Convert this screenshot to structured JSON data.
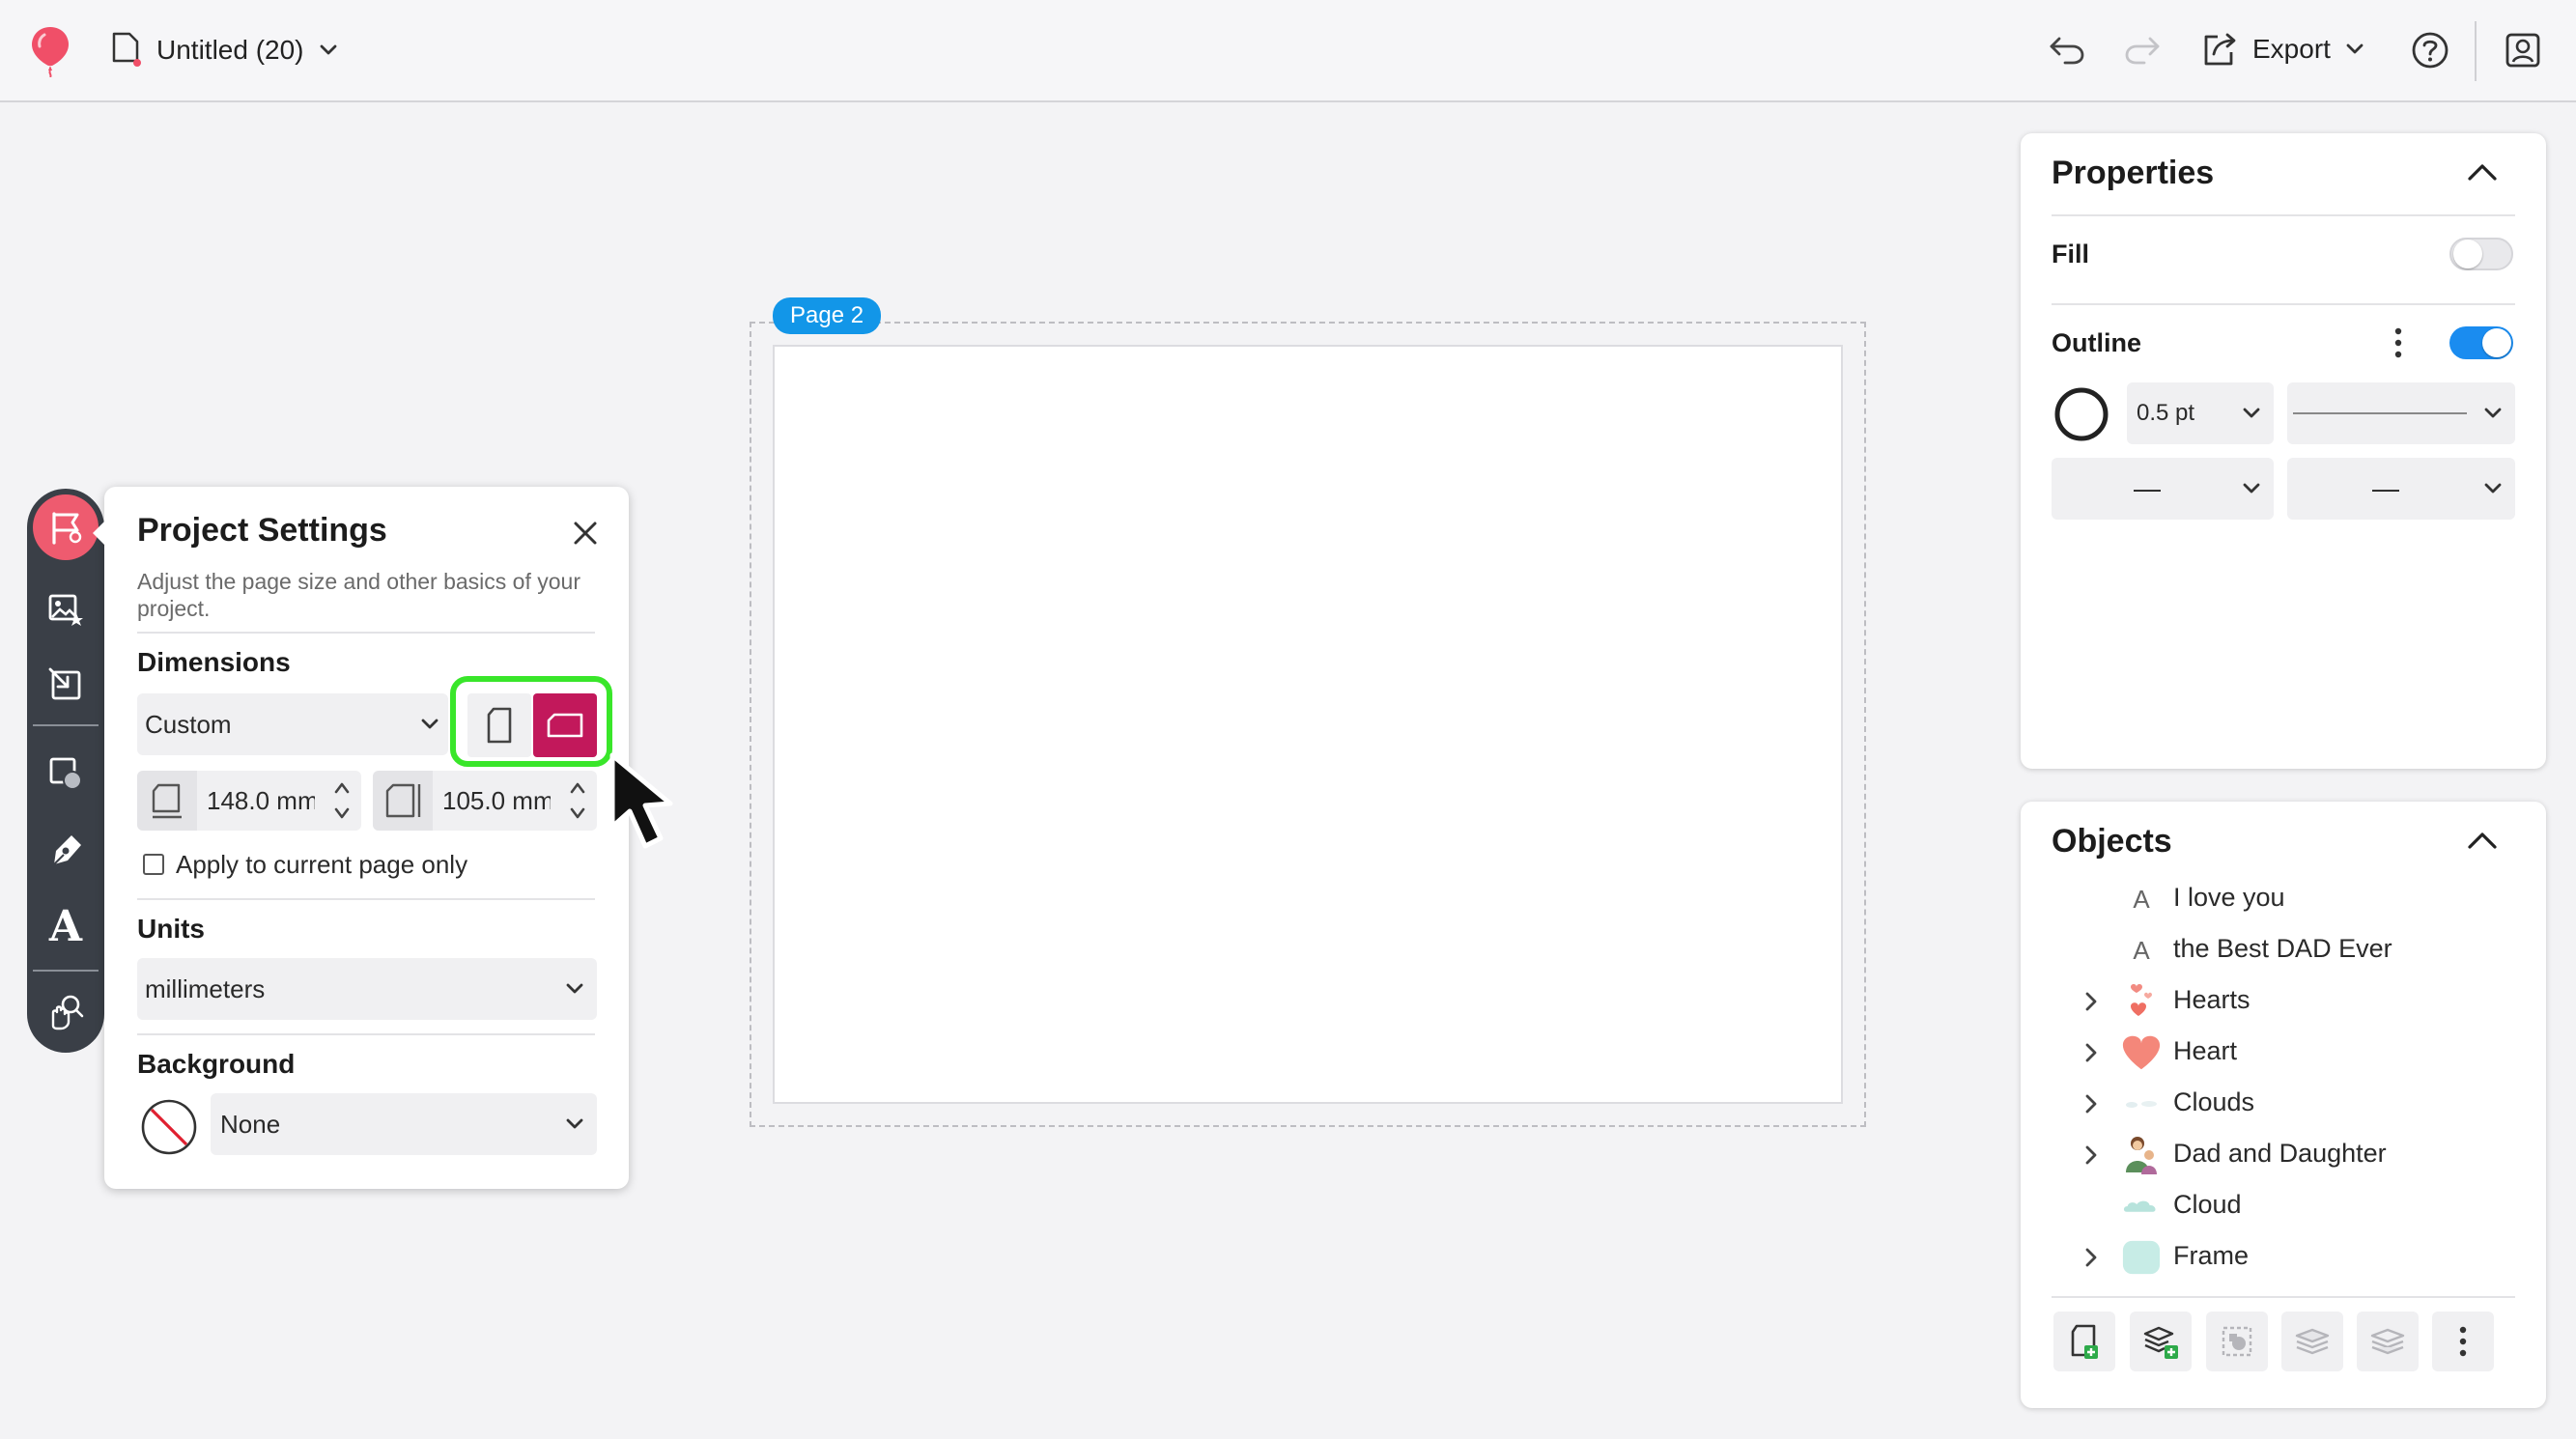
{
  "app": {
    "title": "Untitled (20)",
    "export_label": "Export",
    "logo_icon": "balloon-logo-icon"
  },
  "canvas": {
    "page_tag": "Page 2"
  },
  "toolbar": {
    "tools": [
      "project-settings-icon",
      "image-icon",
      "resize-icon",
      "shapes-icon",
      "pen-icon",
      "text-tool-icon",
      "pan-zoom-icon"
    ],
    "text_tool_glyph": "A"
  },
  "project_settings": {
    "title": "Project Settings",
    "description": "Adjust the page size and other basics of your project.",
    "dimensions_label": "Dimensions",
    "preset_value": "Custom",
    "orientation_selected": "landscape",
    "width_value": "148.0 mm",
    "height_value": "105.0 mm",
    "apply_label": "Apply to current page only",
    "apply_checked": false,
    "units_label": "Units",
    "units_value": "millimeters",
    "background_label": "Background",
    "background_value": "None"
  },
  "properties": {
    "title": "Properties",
    "fill_label": "Fill",
    "fill_enabled": false,
    "outline_label": "Outline",
    "outline_enabled": true,
    "outline_width": "0.5 pt",
    "start_cap": "—",
    "end_cap": "—"
  },
  "objects": {
    "title": "Objects",
    "items": [
      {
        "label": "I love you",
        "icon": "text-glyph-icon",
        "expandable": false
      },
      {
        "label": "the Best DAD Ever",
        "icon": "text-glyph-icon",
        "expandable": false
      },
      {
        "label": "Hearts",
        "icon": "hearts-thumbnail-icon",
        "expandable": true
      },
      {
        "label": "Heart",
        "icon": "heart-thumbnail-icon",
        "expandable": true
      },
      {
        "label": "Clouds",
        "icon": "clouds-thumbnail-icon",
        "expandable": true
      },
      {
        "label": "Dad and Daughter",
        "icon": "dad-daughter-thumbnail-icon",
        "expandable": true
      },
      {
        "label": "Cloud",
        "icon": "cloud-thumbnail-icon",
        "expandable": false
      },
      {
        "label": "Frame",
        "icon": "frame-thumbnail-icon",
        "expandable": true
      }
    ],
    "text_glyph": "A"
  },
  "colors": {
    "accent_pink": "#c2185b",
    "highlight_green": "#39e62a",
    "toggle_blue": "#1a8cf0",
    "page_tag_blue": "#1296e8",
    "toolbar_dark": "#3a3f47",
    "active_tool": "#ee5b6f"
  }
}
